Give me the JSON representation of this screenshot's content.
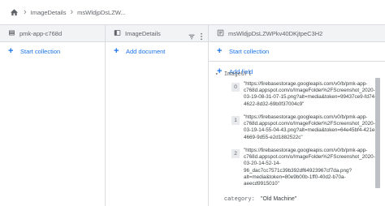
{
  "breadcrumb": {
    "items": [
      "ImageDetails",
      "msWldjpDsLZW..."
    ]
  },
  "columns": [
    {
      "title": "pmk-app-c768d",
      "action": "Start collection"
    },
    {
      "title": "ImageDetails",
      "action": "Add document"
    },
    {
      "title": "msWldjpDsLZWPkv40DKjtpeC3H2",
      "action1": "Start collection",
      "action2": "Add field"
    }
  ],
  "document": {
    "array_field": {
      "name": "ImageUrl",
      "items": [
        {
          "index": "0",
          "value": "\"https://firebasestorage.googleapis.com/v0/b/pmk-app-\nc768d.appspot.com/o/ImageFolder%2FScreenshot_2020-\n03-19-08-31-07-15.png?alt=media&token=99437ce9-fd74-\n4622-8d32-69b0f37004c9\""
        },
        {
          "index": "1",
          "value": "\"https://firebasestorage.googleapis.com/v0/b/pmk-app-\nc768d.appspot.com/o/ImageFolder%2FScreenshot_2020-\n03-19-14-55-04-43.png?alt=media&token=64e45bf4-421e-\n4669-9d55-e2d1882522c\""
        },
        {
          "index": "2",
          "value": "\"https://firebasestorage.googleapis.com/v0/b/pmk-app-\nc768d.appspot.com/o/ImageFolder%2FScreenshot_2020-\n03-20-14-52-14-\n96_dac7cc7571c39b392df64923967cf7da.png?\nalt=media&token=80e9b00b-1ff0-40d2-b70a-\naeecd9915010\""
        }
      ]
    },
    "category_key": "category:",
    "category_value": "\"Old Machine\""
  }
}
